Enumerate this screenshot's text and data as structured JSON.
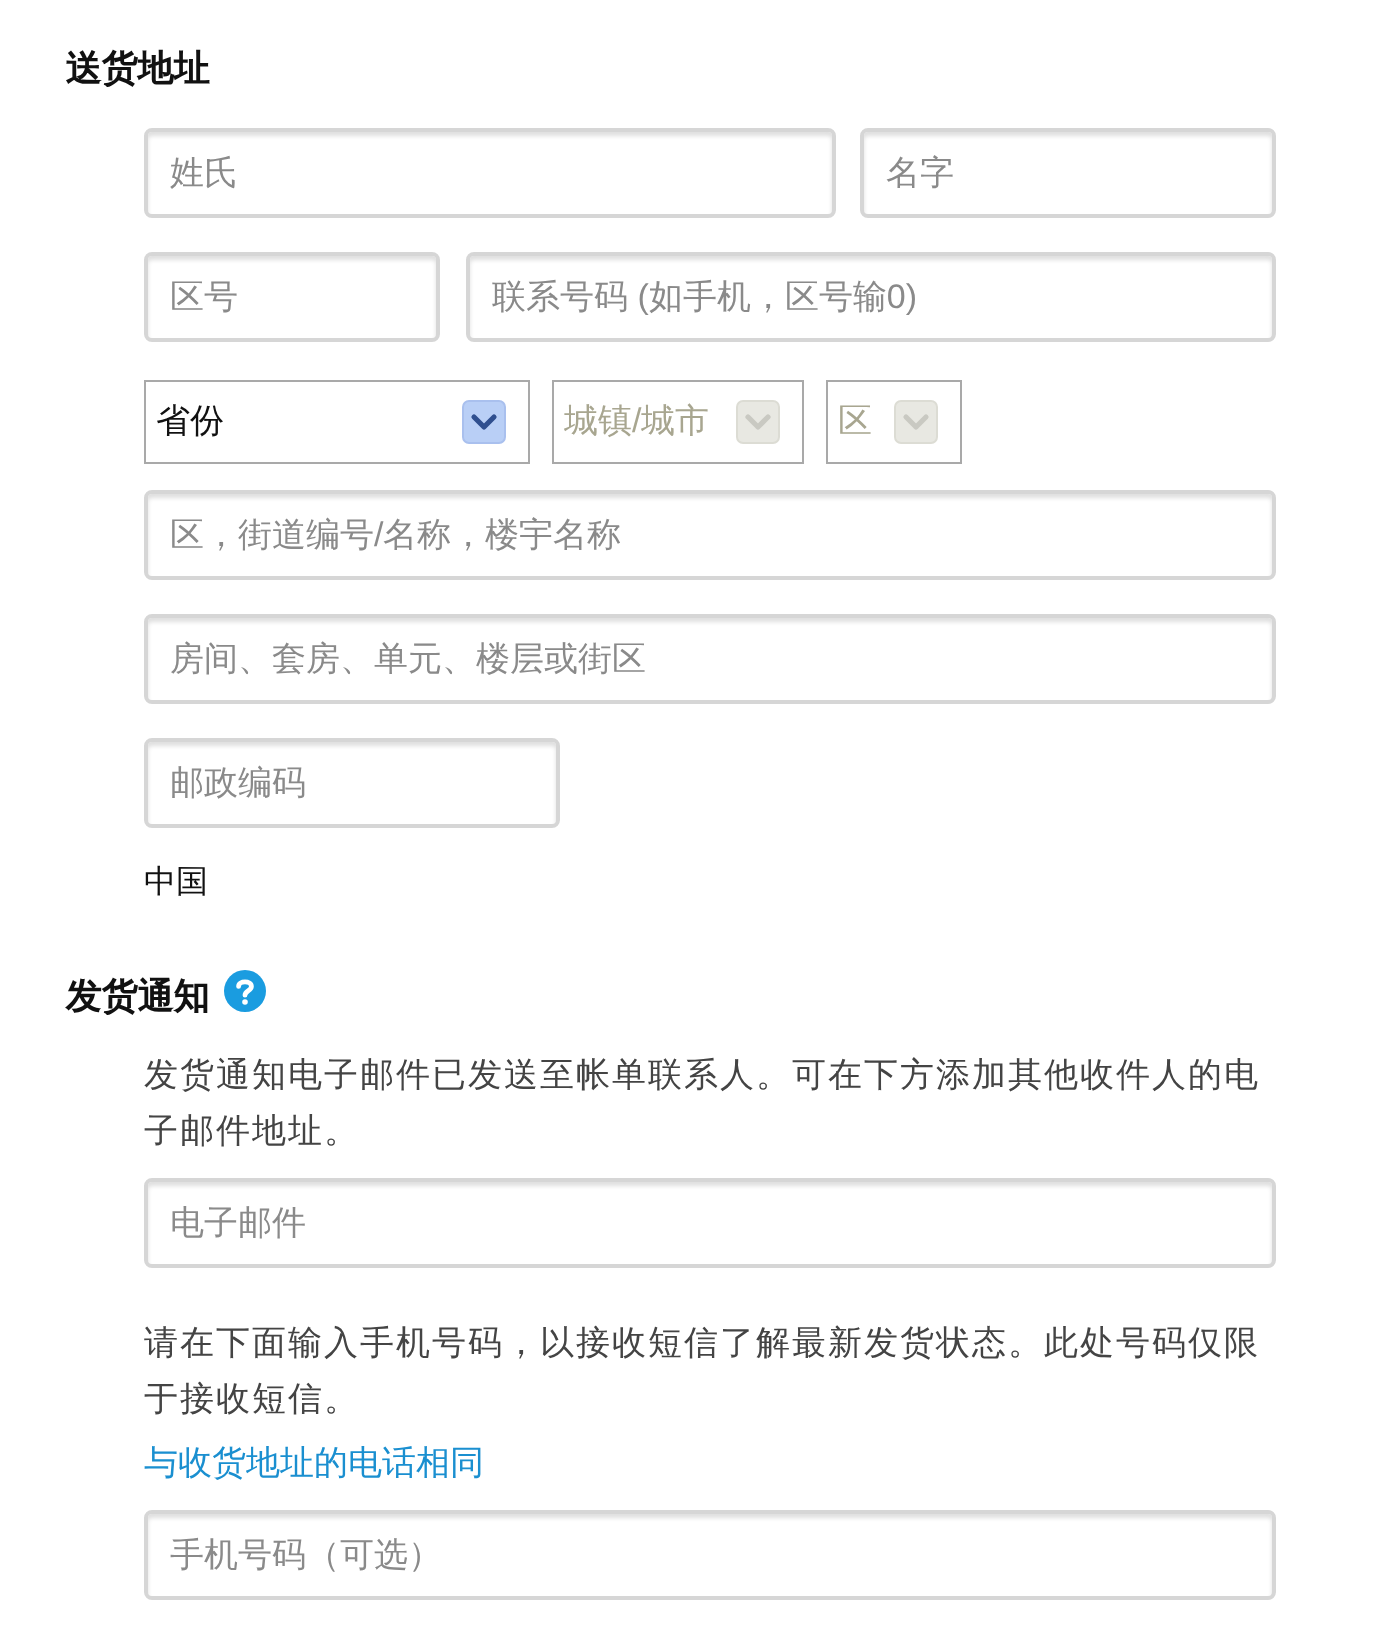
{
  "shipping_address": {
    "heading": "送货地址",
    "last_name": {
      "placeholder": "姓氏"
    },
    "first_name": {
      "placeholder": "名字"
    },
    "area_code": {
      "placeholder": "区号"
    },
    "phone": {
      "placeholder": "联系号码 (如手机，区号输0)"
    },
    "province": {
      "label": "省份",
      "disabled": false
    },
    "city": {
      "label": "城镇/城市",
      "disabled": true
    },
    "district": {
      "label": "区",
      "disabled": true
    },
    "street": {
      "placeholder": "区，街道编号/名称，楼宇名称"
    },
    "unit": {
      "placeholder": "房间、套房、单元、楼层或街区"
    },
    "postal_code": {
      "placeholder": "邮政编码"
    },
    "country": "中国"
  },
  "shipping_notification": {
    "heading": "发货通知",
    "email_note": "发货通知电子邮件已发送至帐单联系人。可在下方添加其他收件人的电子邮件地址。",
    "email": {
      "placeholder": "电子邮件"
    },
    "sms_note": "请在下面输入手机号码，以接收短信了解最新发货状态。此处号码仅限于接收短信。",
    "same_phone_link": "与收货地址的电话相同",
    "mobile": {
      "placeholder": "手机号码（可选）"
    }
  }
}
